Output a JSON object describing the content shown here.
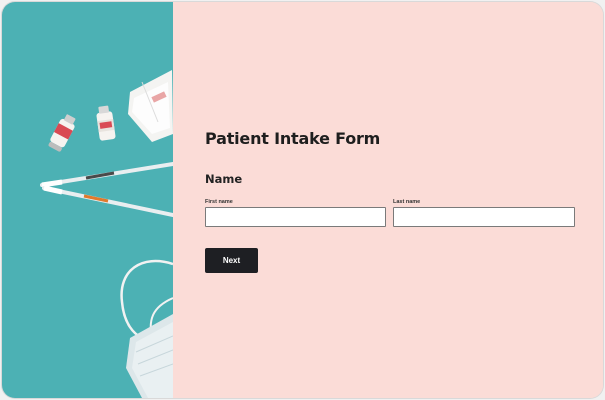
{
  "form": {
    "title": "Patient Intake Form",
    "section_title": "Name",
    "first_name_label": "First name",
    "first_name_value": "",
    "last_name_label": "Last name",
    "last_name_value": "",
    "next_label": "Next"
  },
  "colors": {
    "panel_background": "#fbdcd7",
    "photo_background": "#4cb1b4",
    "button_background": "#1e1f23"
  },
  "icons": [
    "medical-supplies-photo"
  ]
}
